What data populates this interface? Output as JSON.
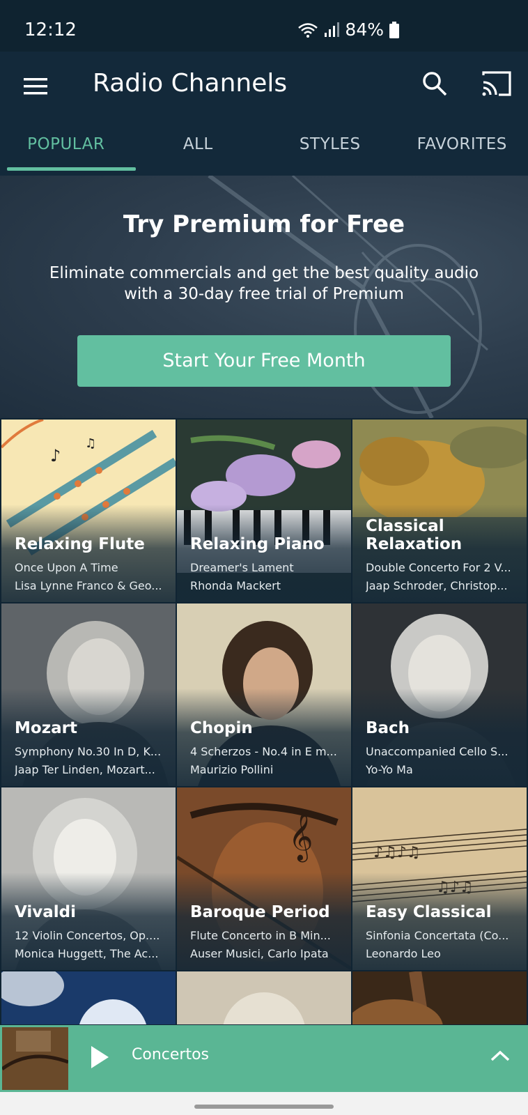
{
  "status_bar": {
    "time": "12:12",
    "battery": "84%"
  },
  "app_bar": {
    "title": "Radio Channels"
  },
  "tabs": [
    {
      "label": "POPULAR"
    },
    {
      "label": "ALL"
    },
    {
      "label": "STYLES"
    },
    {
      "label": "FAVORITES"
    }
  ],
  "promo": {
    "title": "Try Premium for Free",
    "description": "Eliminate commercials and get the best quality audio with a 30-day free trial of Premium",
    "button_label": "Start Your Free Month"
  },
  "channels": [
    {
      "title": "Relaxing Flute",
      "track": "Once Upon A Time",
      "artist": "Lisa Lynne Franco & Geo..."
    },
    {
      "title": "Relaxing Piano",
      "track": "Dreamer's Lament",
      "artist": "Rhonda Mackert"
    },
    {
      "title": "Classical Relaxation",
      "track": "Double Concerto For 2 V...",
      "artist": "Jaap Schroder, Christop..."
    },
    {
      "title": "Mozart",
      "track": "Symphony No.30 In D, K...",
      "artist": "Jaap Ter Linden, Mozart..."
    },
    {
      "title": "Chopin",
      "track": "4 Scherzos - No.4 in E m...",
      "artist": "Maurizio Pollini"
    },
    {
      "title": "Bach",
      "track": "Unaccompanied Cello S...",
      "artist": "Yo-Yo Ma"
    },
    {
      "title": "Vivaldi",
      "track": "12 Violin Concertos, Op....",
      "artist": "Monica Huggett, The Ac..."
    },
    {
      "title": "Baroque Period",
      "track": "Flute Concerto in B Min...",
      "artist": "Auser Musici, Carlo Ipata"
    },
    {
      "title": "Easy Classical",
      "track": "Sinfonia Concertata (Co...",
      "artist": "Leonardo Leo"
    }
  ],
  "player": {
    "title": "Concertos"
  },
  "colors": {
    "accent": "#62bfa0",
    "app_bar": "#13293a",
    "player": "#5ab694"
  }
}
